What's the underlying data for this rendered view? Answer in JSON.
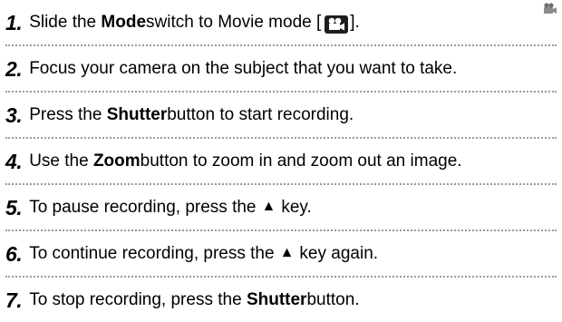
{
  "steps": [
    {
      "number": "1.",
      "parts": {
        "a": "Slide the ",
        "b": "Mode",
        "c": " switch to Movie mode [",
        "d": "]."
      }
    },
    {
      "number": "2.",
      "parts": {
        "a": "Focus your camera on the subject that you want to take."
      }
    },
    {
      "number": "3.",
      "parts": {
        "a": "Press the ",
        "b": "Shutter",
        "c": " button to start recording."
      }
    },
    {
      "number": "4.",
      "parts": {
        "a": "Use the ",
        "b": "Zoom",
        "c": " button to zoom in and zoom out an image."
      }
    },
    {
      "number": "5.",
      "parts": {
        "a": "To pause recording, press the",
        "b": "key."
      }
    },
    {
      "number": "6.",
      "parts": {
        "a": "To continue recording, press the",
        "b": "key again."
      }
    },
    {
      "number": "7.",
      "parts": {
        "a": "To stop recording, press the ",
        "b": "Shutter",
        "c": " button."
      }
    }
  ],
  "icons": {
    "up_key": "▲",
    "movie_mode": "movie-camera-icon",
    "corner": "movie-mode-corner-icon"
  },
  "colors": {
    "text": "#000000",
    "separator": "#9a9a9a",
    "icon": "#1e1e1e"
  }
}
